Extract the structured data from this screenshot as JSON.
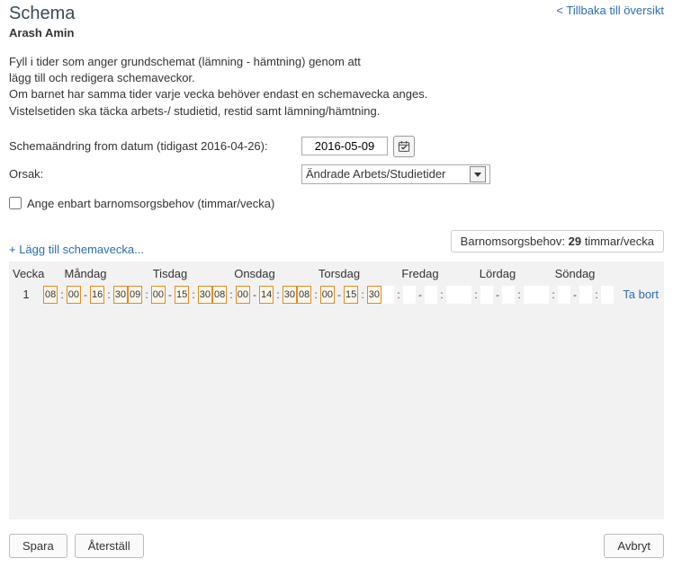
{
  "header": {
    "title": "Schema",
    "student": "Arash Amin",
    "backlink": "< Tillbaka till översikt"
  },
  "intro": {
    "line1": "Fyll i tider som anger grundschemat (lämning - hämtning) genom att",
    "line2": "lägg till och redigera schemaveckor.",
    "line3": "Om barnet har samma tider varje vecka behöver endast en schemavecka anges.",
    "line4": "Vistelsetiden ska täcka arbets-/ studietid, restid samt lämning/hämtning."
  },
  "form": {
    "date_label": "Schemaändring from datum (tidigast 2016-04-26):",
    "date_value": "2016-05-09",
    "reason_label": "Orsak:",
    "reason_value": "Ändrade Arbets/Studietider",
    "checkbox_label": "Ange enbart barnomsorgsbehov (timmar/vecka)"
  },
  "addlink": "+ Lägg till schemavecka...",
  "badge": {
    "prefix": "Barnomsorgsbehov: ",
    "value": "29",
    "suffix": " timmar/vecka"
  },
  "days": {
    "vecka": "Vecka",
    "mon": "Måndag",
    "tue": "Tisdag",
    "wed": "Onsdag",
    "thu": "Torsdag",
    "fri": "Fredag",
    "sat": "Lördag",
    "sun": "Söndag"
  },
  "row": {
    "num": "1",
    "mon": {
      "sh": "08",
      "sm": "00",
      "eh": "16",
      "em": "30"
    },
    "tue": {
      "sh": "09",
      "sm": "00",
      "eh": "15",
      "em": "30"
    },
    "wed": {
      "sh": "08",
      "sm": "00",
      "eh": "14",
      "em": "30"
    },
    "thu": {
      "sh": "08",
      "sm": "00",
      "eh": "15",
      "em": "30"
    },
    "remove": "Ta bort"
  },
  "footer": {
    "save": "Spara",
    "reset": "Återställ",
    "cancel": "Avbryt"
  }
}
